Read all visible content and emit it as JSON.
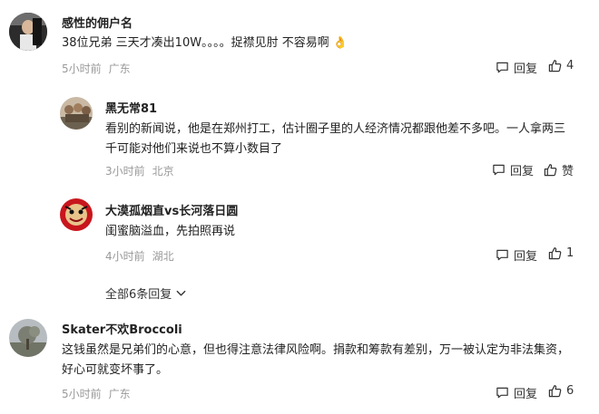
{
  "comments": [
    {
      "username": "感性的佣户名",
      "text": "38位兄弟 三天才凑出10W。。。。捉襟见肘 不容易啊",
      "emoji": "👌",
      "time": "5小时前",
      "location": "广东",
      "reply_label": "回复",
      "like_count": "4",
      "replies": [
        {
          "username": "黑无常81",
          "text": "看别的新闻说，他是在郑州打工，估计圈子里的人经济情况都跟他差不多吧。一人拿两三千可能对他们来说也不算小数目了",
          "time": "3小时前",
          "location": "北京",
          "reply_label": "回复",
          "like_count": "赞"
        },
        {
          "username": "大漠孤烟直vs长河落日圆",
          "text": "闺蜜脑溢血，先拍照再说",
          "time": "4小时前",
          "location": "湖北",
          "reply_label": "回复",
          "like_count": "1"
        }
      ],
      "expand_label": "全部6条回复"
    },
    {
      "username": "Skater不欢Broccoli",
      "text": "这钱虽然是兄弟们的心意，但也得注意法律风险啊。捐款和筹款有差别，万一被认定为非法集资，好心可就变坏事了。",
      "time": "5小时前",
      "location": "广东",
      "reply_label": "回复",
      "like_count": "6"
    }
  ],
  "icons": {
    "reply": "comment-bubble-icon",
    "like": "thumbs-up-icon",
    "expand": "chevron-down-icon"
  }
}
